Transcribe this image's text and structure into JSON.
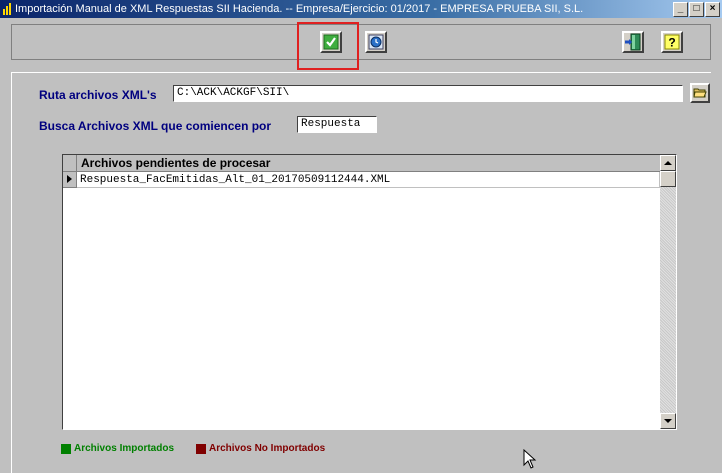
{
  "window": {
    "title": "Importación Manual de XML Respuestas SII Hacienda. -- Empresa/Ejercicio: 01/2017 - EMPRESA PRUEBA SII, S.L.",
    "minimize": "_",
    "maximize": "□",
    "close": "×"
  },
  "toolbar": {
    "accept_icon": "green-check-icon",
    "clock_icon": "clock-icon",
    "exit_icon": "exit-door-icon",
    "help_icon": "help-question-icon",
    "help_label": "?"
  },
  "form": {
    "ruta_label": "Ruta archivos XML's",
    "ruta_value": "C:\\ACK\\ACKGF\\SII\\",
    "busca_label": "Busca Archivos XML que comiencen por",
    "busca_value": "Respuesta"
  },
  "grid": {
    "column_header": "Archivos pendientes de procesar",
    "rows": [
      "Respuesta_FacEmitidas_Alt_01_20170509112444.XML"
    ]
  },
  "legend": {
    "imported_label": "Archivos Importados",
    "imported_color": "#008000",
    "not_imported_label": "Archivos No Importados",
    "not_imported_color": "#800000"
  }
}
